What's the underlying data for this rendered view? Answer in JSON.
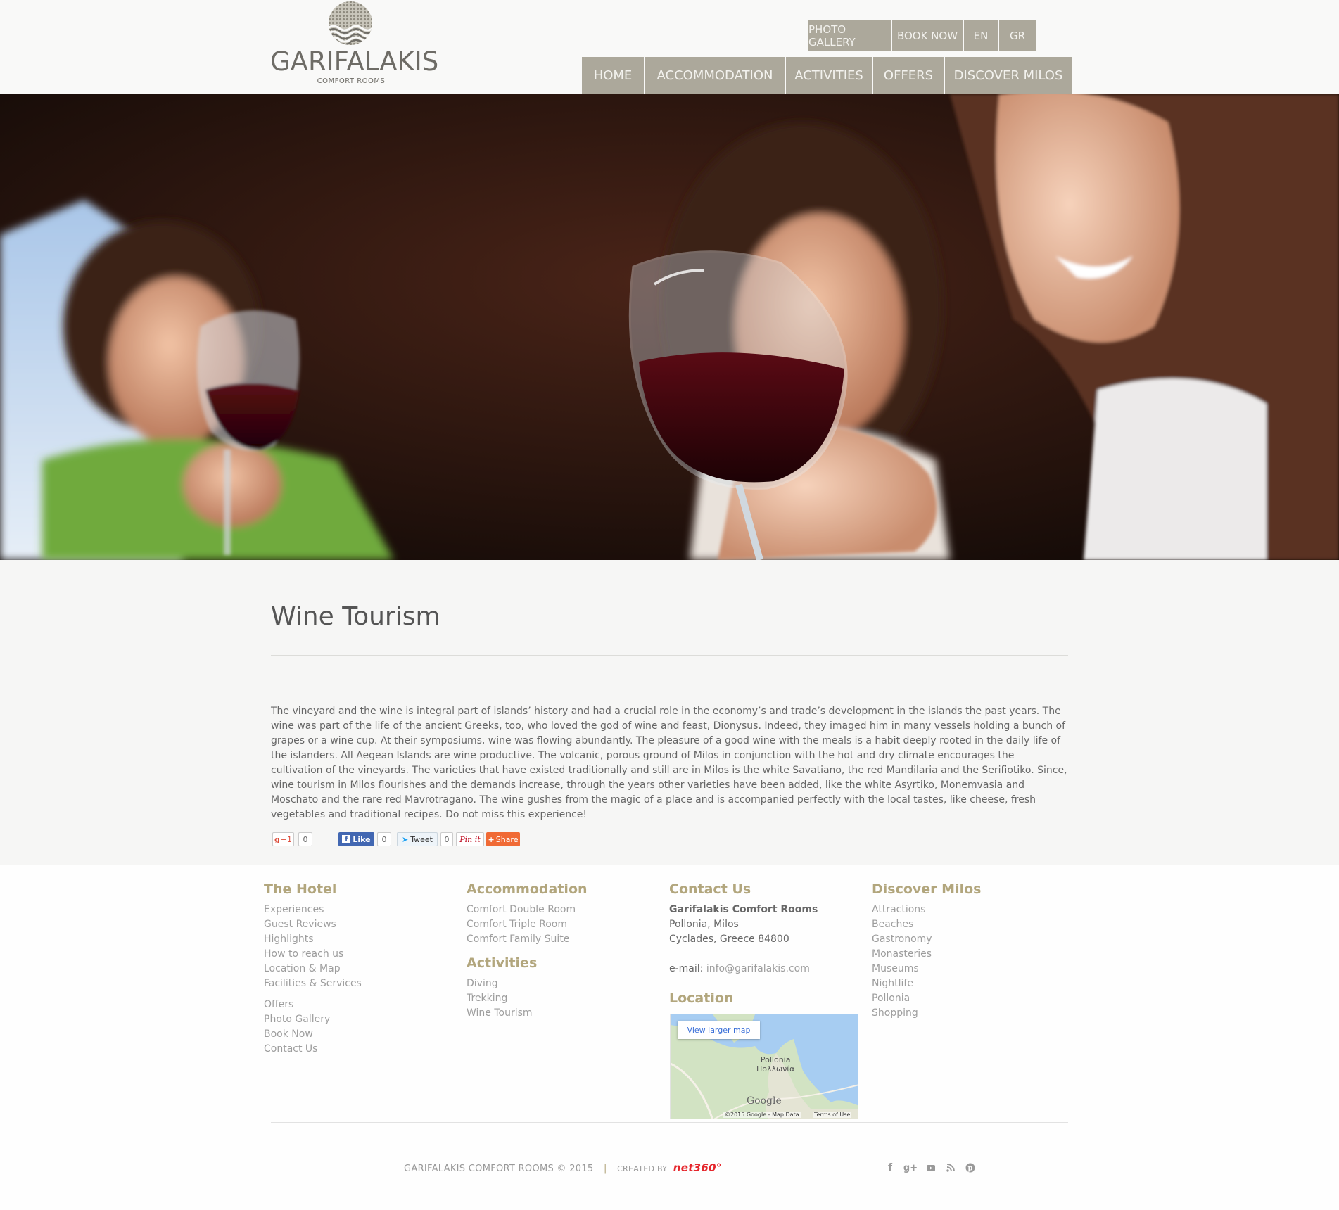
{
  "header": {
    "brand": "GARIFALAKIS",
    "brand_sub": "COMFORT ROOMS",
    "top_links": [
      "PHOTO GALLERY",
      "BOOK NOW",
      "EN",
      "GR"
    ],
    "nav": [
      "HOME",
      "ACCOMMODATION",
      "ACTIVITIES",
      "OFFERS",
      "DISCOVER MILOS"
    ]
  },
  "main": {
    "title": "Wine Tourism",
    "body": "The vineyard and the wine is integral part of islands’ history and had a crucial role in the economy’s and trade’s development in the islands the past years. The wine was part of the life of the ancient Greeks, too, who loved the god of wine and feast, Dionysus. Indeed, they imaged him in many vessels holding a bunch of grapes or a wine cup. At their symposiums, wine was flowing abundantly. The pleasure of a good wine with the meals is a habit deeply rooted in the daily life of the islanders. All Aegean Islands are wine productive. The volcanic, porous ground of Milos in conjunction with the hot and dry climate encourages the cultivation of the vineyards. The varieties that have existed traditionally and still are in Milos is the white Savatiano, the red Mandilaria and the Serifiotiko. Since, wine tourism in Milos flourishes and the demands increase, through the years other varieties have been added, like the white Asyrtiko, Monemvasia and Moschato and the rare red Mavrotragano. The wine gushes from the magic of a place and is accompanied perfectly with the local tastes, like cheese, fresh vegetables and traditional recipes. Do not miss this experience!",
    "share": {
      "gplus": "+1",
      "gplus_count": "0",
      "like": "Like",
      "like_count": "0",
      "tweet": "Tweet",
      "tweet_count": "0",
      "pin": "Pin it",
      "share": "Share"
    }
  },
  "footer": {
    "hotel": {
      "heading": "The Hotel",
      "links": [
        "Experiences",
        "Guest Reviews",
        "Highlights",
        "How to reach us",
        "Location & Map",
        "Facilities & Services"
      ],
      "links2": [
        "Offers",
        "Photo Gallery",
        "Book Now",
        "Contact Us"
      ]
    },
    "accommodation": {
      "heading": "Accommodation",
      "links": [
        "Comfort Double Room",
        "Comfort Triple Room",
        "Comfort Family Suite"
      ]
    },
    "activities": {
      "heading": "Activities",
      "links": [
        "Diving",
        "Trekking",
        "Wine Tourism"
      ]
    },
    "contact": {
      "heading": "Contact Us",
      "name": "Garifalakis Comfort Rooms",
      "address1": "Pollonia, Milos",
      "address2": "Cyclades, Greece 84800",
      "email_label": "e-mail:",
      "email": "info@garifalakis.com"
    },
    "location": {
      "heading": "Location",
      "map_button": "View larger map",
      "place_en": "Pollonia",
      "place_gr": "Πολλωνία",
      "google": "Google",
      "map_data": "©2015 Google - Map Data",
      "terms": "Terms of Use"
    },
    "discover": {
      "heading": "Discover Milos",
      "links": [
        "Attractions",
        "Beaches",
        "Gastronomy",
        "Monasteries",
        "Museums",
        "Nightlife",
        "Pollonia",
        "Shopping"
      ]
    },
    "copyright": "GARIFALAKIS COMFORT ROOMS © 2015",
    "separator": "|",
    "created_by": "CREATED BY",
    "creator": "net360°",
    "social_icons": [
      "facebook-icon",
      "google-plus-icon",
      "youtube-icon",
      "rss-icon",
      "pinterest-icon"
    ]
  },
  "colors": {
    "nav_bg": "#aca89b",
    "footer_heading": "#b2a67d",
    "creator_red": "#e5262c"
  }
}
